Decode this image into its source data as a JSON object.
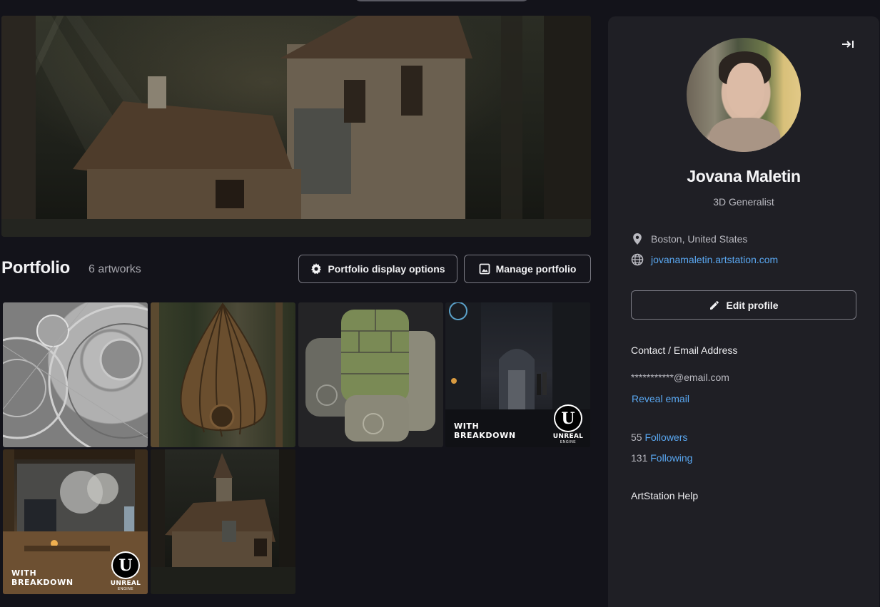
{
  "portfolio": {
    "title": "Portfolio",
    "artwork_count": "6 artworks",
    "display_options_label": "Portfolio display options",
    "manage_label": "Manage portfolio",
    "items": [
      {
        "subject": "gear mechanism wireframe render"
      },
      {
        "subject": "woven seed pod house in forest"
      },
      {
        "subject": "mossy stone brick cylinders material"
      },
      {
        "subject": "dark sci-fi alley",
        "badge_text": [
          "WITH",
          "BREAKDOWN"
        ],
        "engine_text": [
          "UNREAL",
          "ENGINE"
        ]
      },
      {
        "subject": "japanese interior room",
        "badge_text": [
          "WITH",
          "BREAKDOWN"
        ],
        "engine_text": [
          "UNREAL",
          "ENGINE"
        ]
      },
      {
        "subject": "fantasy timber house in forest"
      }
    ]
  },
  "profile": {
    "name": "Jovana Maletin",
    "role": "3D Generalist",
    "location": "Boston, United States",
    "website": "jovanamaletin.artstation.com",
    "edit_label": "Edit profile",
    "contact_title": "Contact / Email Address",
    "email_masked": "***********@email.com",
    "reveal_email_label": "Reveal email",
    "followers_count": "55",
    "followers_label": "Followers",
    "following_count": "131",
    "following_label": "Following",
    "help_label": "ArtStation Help"
  },
  "colors": {
    "background": "#13131a",
    "sidebar": "#1f1f25",
    "link": "#5aa8f2",
    "border": "#7a7a83"
  }
}
